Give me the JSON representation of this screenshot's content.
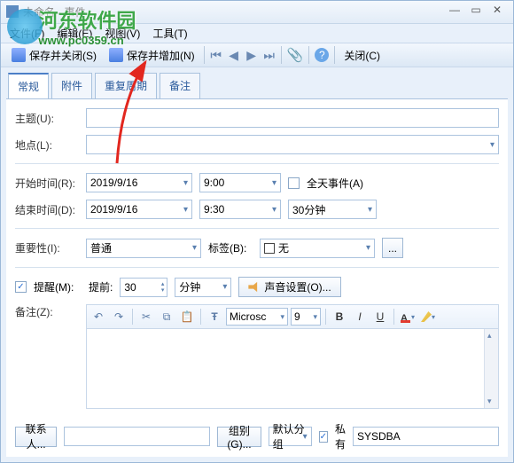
{
  "titlebar": {
    "title": "未命名 - 事件"
  },
  "menubar": {
    "file": "文件(F)",
    "edit": "编辑(E)",
    "view": "视图(V)",
    "tool": "工具(T)"
  },
  "toolbar": {
    "save_close": "保存并关闭(S)",
    "save_add": "保存并增加(N)",
    "close": "关闭(C)"
  },
  "tabs": {
    "general": "常规",
    "attach": "附件",
    "recur": "重复周期",
    "note": "备注"
  },
  "labels": {
    "subject": "主题(U):",
    "location": "地点(L):",
    "start": "开始时间(R):",
    "end": "结束时间(D):",
    "allday": "全天事件(A)",
    "importance": "重要性(I):",
    "tag": "标签(B):",
    "remind": "提醒(M):",
    "before": "提前:",
    "remark": "备注(Z):",
    "contact": "联系人...",
    "group": "组别(G)...",
    "private": "私有"
  },
  "values": {
    "start_date": "2019/9/16",
    "start_time": "9:00",
    "end_date": "2019/9/16",
    "end_time": "9:30",
    "duration": "30分钟",
    "importance": "普通",
    "tag": "无",
    "remind_val": "30",
    "remind_unit": "分钟",
    "sound_btn": "声音设置(O)...",
    "font": "Microsc",
    "font_size": "9",
    "default_group": "默认分组",
    "owner": "SYSDBA",
    "remind_checked": true,
    "private_checked": true
  },
  "watermark": {
    "line1": "河东软件园",
    "line2": "www.pc0359.cn"
  }
}
